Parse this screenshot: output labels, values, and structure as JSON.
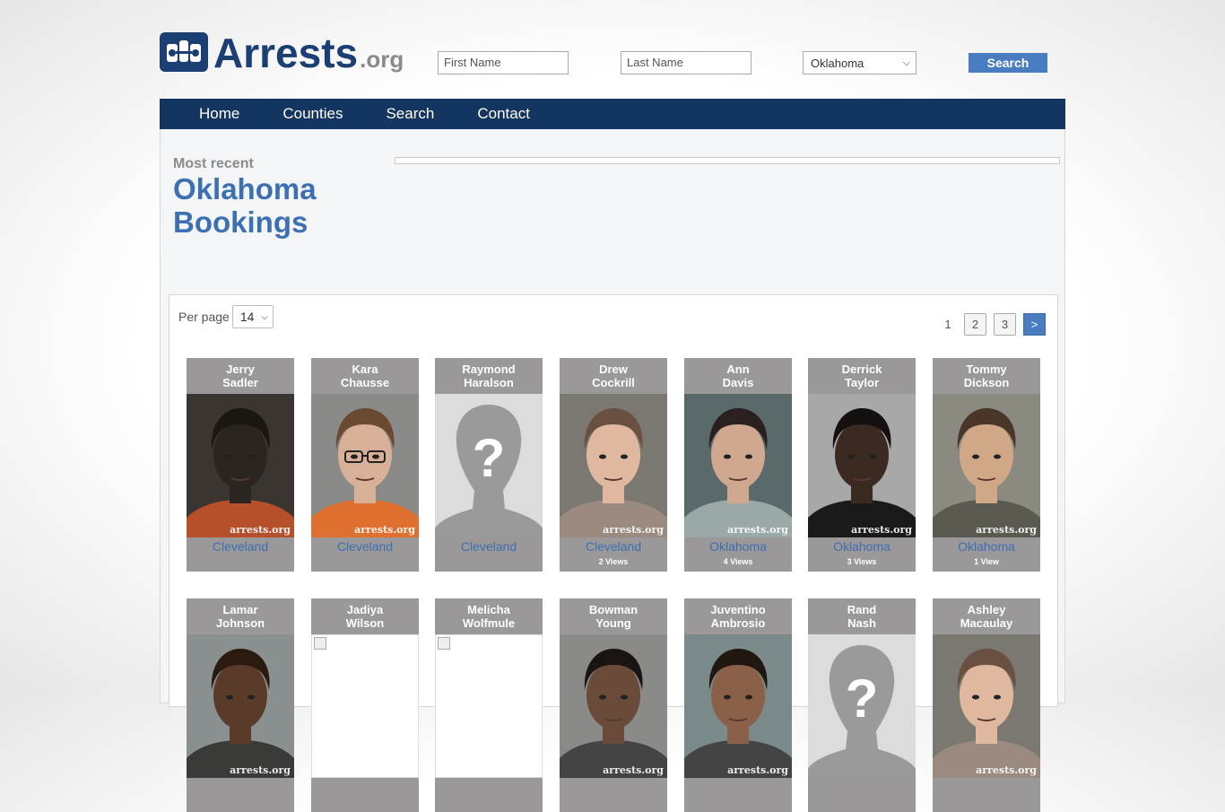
{
  "site": {
    "brand": "Arrests",
    "tld": ".org"
  },
  "search": {
    "first_placeholder": "First Name",
    "last_placeholder": "Last Name",
    "state_selected": "Oklahoma",
    "button_label": "Search"
  },
  "nav": [
    "Home",
    "Counties",
    "Search",
    "Contact"
  ],
  "main": {
    "eyebrow": "Most recent",
    "title_line1": "Oklahoma",
    "title_line2": "Bookings"
  },
  "list": {
    "per_page_label": "Per page",
    "per_page_value": "14"
  },
  "pagination": {
    "current": "1",
    "pages": [
      "2",
      "3"
    ],
    "next": ">"
  },
  "watermark": "arrests.org",
  "colors": {
    "nav": "#14355f",
    "accent": "#3d6fb3",
    "button": "#4a7cc0",
    "card": "#9a9898"
  },
  "bookings": [
    {
      "first": "Jerry",
      "last": "Sadler",
      "county": "Cleveland",
      "views": "",
      "photo": "dark"
    },
    {
      "first": "Kara",
      "last": "Chausse",
      "county": "Cleveland",
      "views": "",
      "photo": "female-glasses"
    },
    {
      "first": "Raymond",
      "last": "Haralson",
      "county": "Cleveland",
      "views": "",
      "photo": "placeholder"
    },
    {
      "first": "Drew",
      "last": "Cockrill",
      "county": "Cleveland",
      "views": "2 Views",
      "photo": "male-light"
    },
    {
      "first": "Ann",
      "last": "Davis",
      "county": "Oklahoma",
      "views": "4 Views",
      "photo": "female-dark-hair"
    },
    {
      "first": "Derrick",
      "last": "Taylor",
      "county": "Oklahoma",
      "views": "3 Views",
      "photo": "male-young"
    },
    {
      "first": "Tommy",
      "last": "Dickson",
      "county": "Oklahoma",
      "views": "1 View",
      "photo": "male-long-hair"
    },
    {
      "first": "Lamar",
      "last": "Johnson",
      "county": "",
      "views": "",
      "photo": "male-dreads"
    },
    {
      "first": "Jadiya",
      "last": "Wilson",
      "county": "",
      "views": "",
      "photo": "broken"
    },
    {
      "first": "Melicha",
      "last": "Wolfmule",
      "county": "",
      "views": "",
      "photo": "broken"
    },
    {
      "first": "Bowman",
      "last": "Young",
      "county": "",
      "views": "",
      "photo": "male-dark"
    },
    {
      "first": "Juventino",
      "last": "Ambrosio",
      "county": "",
      "views": "",
      "photo": "male-curly"
    },
    {
      "first": "Rand",
      "last": "Nash",
      "county": "",
      "views": "",
      "photo": "placeholder"
    },
    {
      "first": "Ashley",
      "last": "Macaulay",
      "county": "",
      "views": "",
      "photo": "male-light"
    }
  ]
}
